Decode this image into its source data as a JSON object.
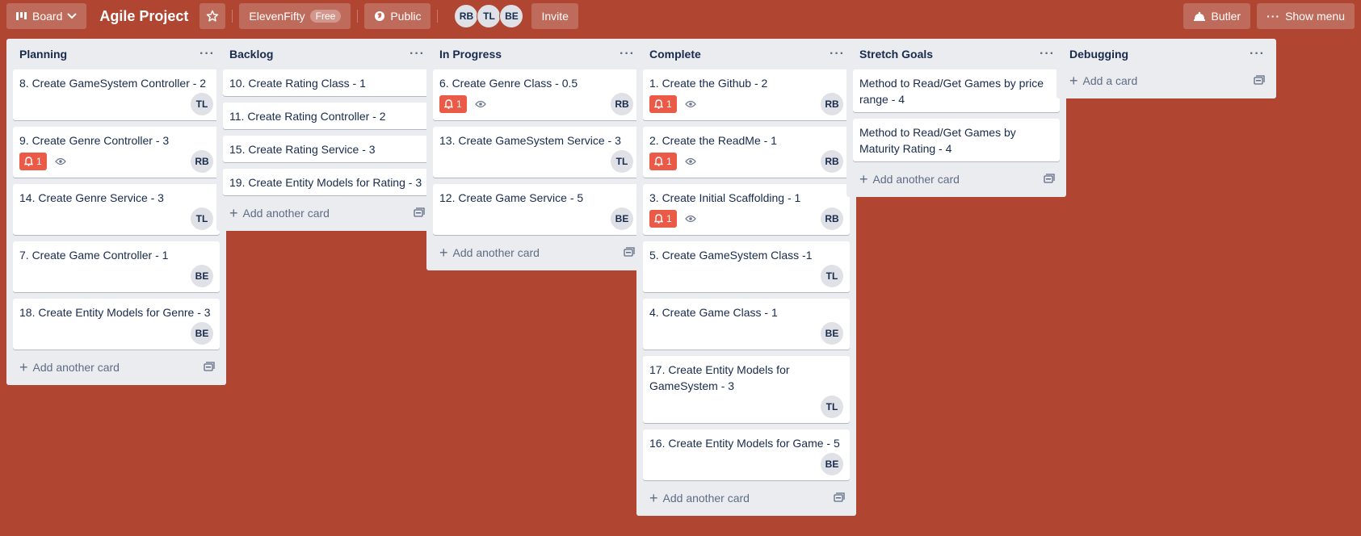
{
  "header": {
    "board_menu_label": "Board",
    "board_title": "Agile Project",
    "team_label": "ElevenFifty",
    "team_badge": "Free",
    "visibility_label": "Public",
    "members": [
      "RB",
      "TL",
      "BE"
    ],
    "invite_label": "Invite",
    "butler_label": "Butler",
    "show_menu_label": "Show menu"
  },
  "colors": {
    "board_background": "#b04632",
    "list_background": "#ebecf0",
    "alert_badge": "#eb5a46"
  },
  "lists": [
    {
      "title": "Planning",
      "add_label": "Add another card",
      "cards": [
        {
          "title": "8. Create GameSystem Controller - 2",
          "member": "TL"
        },
        {
          "title": "9. Create Genre Controller - 3",
          "member": "RB",
          "alert": "1",
          "watch": true
        },
        {
          "title": "14. Create Genre Service - 3",
          "member": "TL"
        },
        {
          "title": "7. Create Game Controller - 1",
          "member": "BE"
        },
        {
          "title": "18. Create Entity Models for Genre - 3",
          "member": "BE"
        }
      ]
    },
    {
      "title": "Backlog",
      "add_label": "Add another card",
      "cards": [
        {
          "title": "10. Create Rating Class - 1"
        },
        {
          "title": "11. Create Rating Controller - 2"
        },
        {
          "title": "15. Create Rating Service - 3"
        },
        {
          "title": "19. Create Entity Models for Rating - 3"
        }
      ]
    },
    {
      "title": "In Progress",
      "add_label": "Add another card",
      "cards": [
        {
          "title": "6. Create Genre Class - 0.5",
          "member": "RB",
          "alert": "1",
          "watch": true
        },
        {
          "title": "13. Create GameSystem Service - 3",
          "member": "TL"
        },
        {
          "title": "12. Create Game Service - 5",
          "member": "BE"
        }
      ]
    },
    {
      "title": "Complete",
      "add_label": "Add another card",
      "cards": [
        {
          "title": "1. Create the Github - 2",
          "member": "RB",
          "alert": "1",
          "watch": true
        },
        {
          "title": "2. Create the ReadMe - 1",
          "member": "RB",
          "alert": "1",
          "watch": true
        },
        {
          "title": "3. Create Initial Scaffolding - 1",
          "member": "RB",
          "alert": "1",
          "watch": true
        },
        {
          "title": "5. Create GameSystem Class -1",
          "member": "TL"
        },
        {
          "title": "4. Create Game Class - 1",
          "member": "BE"
        },
        {
          "title": "17. Create Entity Models for GameSystem - 3",
          "member": "TL"
        },
        {
          "title": "16. Create Entity Models for Game - 5",
          "member": "BE"
        }
      ]
    },
    {
      "title": "Stretch Goals",
      "add_label": "Add another card",
      "cards": [
        {
          "title": "Method to Read/Get Games by price range - 4"
        },
        {
          "title": "Method to Read/Get Games by Maturity Rating - 4"
        }
      ]
    },
    {
      "title": "Debugging",
      "add_label": "Add a card",
      "cards": []
    }
  ]
}
